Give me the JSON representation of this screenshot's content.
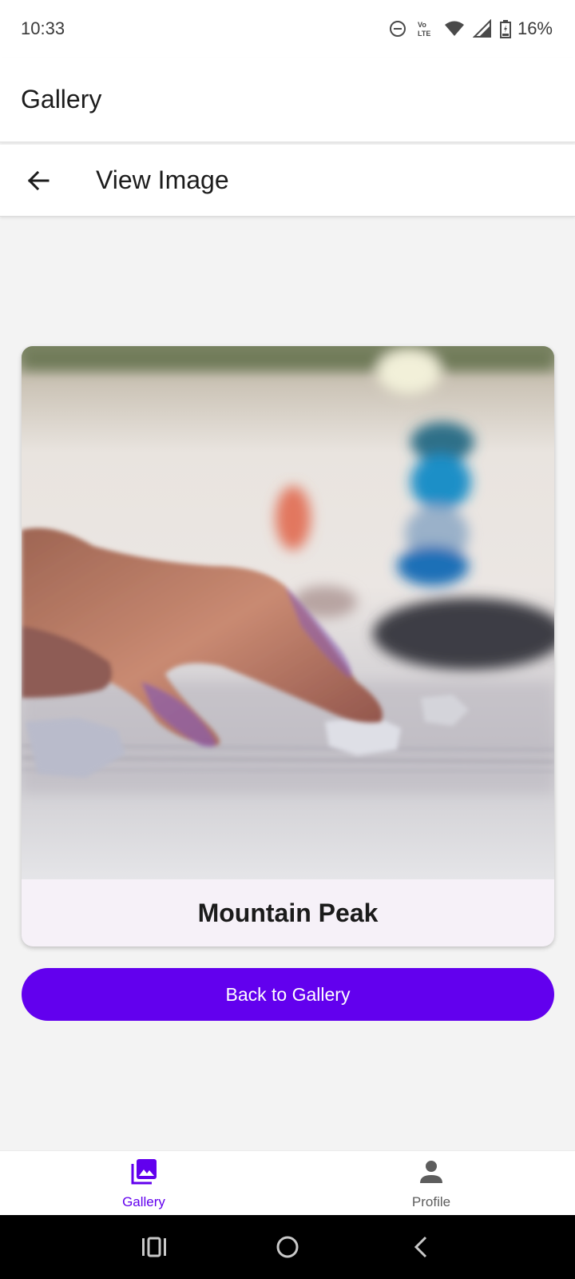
{
  "status_bar": {
    "time": "10:33",
    "lte_label": "LTE",
    "volte_label": "Vo",
    "battery": "16%"
  },
  "app_bar": {
    "title": "Gallery"
  },
  "sub_bar": {
    "title": "View Image"
  },
  "image_card": {
    "caption": "Mountain Peak"
  },
  "actions": {
    "back_to_gallery": "Back to Gallery"
  },
  "bottom_nav": {
    "items": [
      {
        "label": "Gallery",
        "icon": "photo-library-icon",
        "active": true
      },
      {
        "label": "Profile",
        "icon": "person-icon",
        "active": false
      }
    ]
  },
  "colors": {
    "accent": "#6200ee",
    "background": "#f3f3f3",
    "card": "#f6f1f8",
    "inactive_nav": "#5d5d5d"
  }
}
